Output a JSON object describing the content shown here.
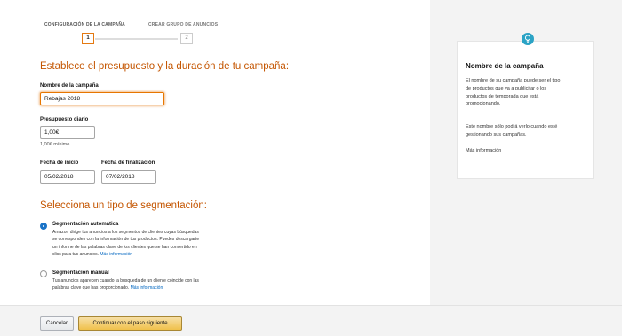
{
  "stepper": {
    "step1_label": "CONFIGURACIÓN DE LA CAMPAÑA",
    "step2_label": "CREAR GRUPO DE ANUNCIOS",
    "step1_number": "1",
    "step2_number": "2"
  },
  "main": {
    "heading": "Establece el presupuesto y la duración de tu campaña:",
    "campaign_name": {
      "label": "Nombre de la campaña",
      "value": "Rebajas 2018"
    },
    "daily_budget": {
      "label": "Presupuesto diario",
      "value": "1,00€",
      "hint": "1,00€ mínimo"
    },
    "start_date": {
      "label": "Fecha de inicio",
      "value": "05/02/2018"
    },
    "end_date": {
      "label": "Fecha de finalización",
      "value": "07/02/2018"
    },
    "targeting_heading": "Selecciona un tipo de segmentación:",
    "targeting": {
      "auto": {
        "title": "Segmentación automática",
        "desc_line1": "Amazon dirige tus anuncios a los segmentos de clientes cuyas búsquedas",
        "desc_line2": "se corresponden con la información de tus productos. Puedes descargarte",
        "desc_line3": "un informe de las palabras clave de los clientes que se han convertido en",
        "desc_line4": "clics para tus anuncios.",
        "link": "Más información",
        "selected": true
      },
      "manual": {
        "title": "Segmentación manual",
        "desc_line1": "Tus anuncios aparecen cuando la búsqueda de un cliente coincide con las",
        "desc_line2": "palabras clave que has proporcionado.",
        "link": "Más información",
        "selected": false
      }
    }
  },
  "side": {
    "title": "Nombre de la campaña",
    "p1_line1": "El nombre de su campaña puede ser el tipo",
    "p1_line2": "de productos que va a publicitar o los",
    "p1_line3": "productos de temporada que está",
    "p1_line4": "promocionando.",
    "p2_line1": "Este nombre sólo podrá verlo cuando esté",
    "p2_line2": "gestionando sus campañas.",
    "link": "Más información",
    "icon": "lightbulb-icon"
  },
  "footer": {
    "cancel_label": "Cancelar",
    "continue_label": "Continuar con el paso siguiente"
  },
  "colors": {
    "heading": "#c45500",
    "accent": "#e47911",
    "link": "#0066c0",
    "radio_selected": "#1a73c7",
    "bulb": "#2ba3c5"
  }
}
